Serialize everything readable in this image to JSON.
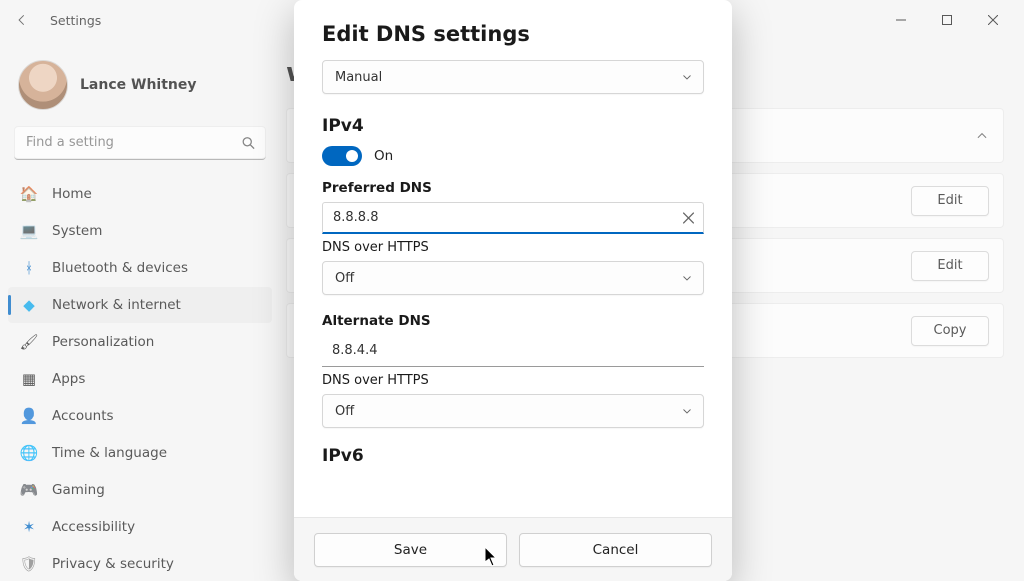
{
  "titlebar": {
    "title": "Settings"
  },
  "user": {
    "name": "Lance Whitney"
  },
  "search": {
    "placeholder": "Find a setting"
  },
  "nav": {
    "items": [
      {
        "label": "Home",
        "icon": "🏠"
      },
      {
        "label": "System",
        "icon": "💻"
      },
      {
        "label": "Bluetooth & devices",
        "icon": "ᚼ"
      },
      {
        "label": "Network & internet",
        "icon": "◆"
      },
      {
        "label": "Personalization",
        "icon": "🖌"
      },
      {
        "label": "Apps",
        "icon": "▦"
      },
      {
        "label": "Accounts",
        "icon": "👤"
      },
      {
        "label": "Time & language",
        "icon": "🌐"
      },
      {
        "label": "Gaming",
        "icon": "🎮"
      },
      {
        "label": "Accessibility",
        "icon": "✶"
      },
      {
        "label": "Privacy & security",
        "icon": "🛡"
      }
    ]
  },
  "main": {
    "page_title_partial": "w additional properties",
    "buttons": {
      "edit": "Edit",
      "copy": "Copy"
    }
  },
  "dialog": {
    "title": "Edit DNS settings",
    "mode_value": "Manual",
    "ipv4": {
      "heading": "IPv4",
      "toggle_state": "On",
      "preferred_label": "Preferred DNS",
      "preferred_value": "8.8.8.8",
      "doh_label": "DNS over HTTPS",
      "doh_value": "Off",
      "alternate_label": "Alternate DNS",
      "alternate_value": "8.8.4.4",
      "doh2_label": "DNS over HTTPS",
      "doh2_value": "Off"
    },
    "ipv6": {
      "heading": "IPv6"
    },
    "save_label": "Save",
    "cancel_label": "Cancel"
  },
  "colors": {
    "accent": "#0067c0"
  }
}
